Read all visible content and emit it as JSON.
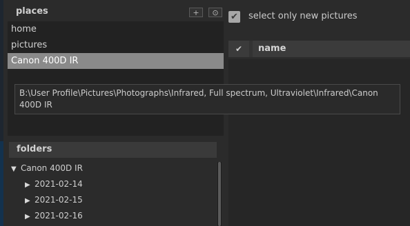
{
  "places": {
    "title": "places",
    "add_button": "+",
    "options_button": "⊙",
    "items": [
      {
        "label": "home",
        "selected": false
      },
      {
        "label": "pictures",
        "selected": false
      },
      {
        "label": "Canon 400D IR",
        "selected": true
      }
    ]
  },
  "tooltip": {
    "text": "B:\\User Profile\\Pictures\\Photographs\\Infrared, Full spectrum, Ultraviolet\\Infrared\\Canon 400D IR"
  },
  "folders": {
    "title": "folders",
    "items": [
      {
        "label": "Canon 400D IR",
        "expanded": true,
        "level": 0
      },
      {
        "label": "2021-02-14",
        "expanded": false,
        "level": 1
      },
      {
        "label": "2021-02-15",
        "expanded": false,
        "level": 1
      },
      {
        "label": "2021-02-16",
        "expanded": false,
        "level": 1
      }
    ]
  },
  "options": {
    "select_new_label": "select only new pictures",
    "select_new_checked": true
  },
  "table": {
    "check_column": "✔",
    "name_column": "name"
  },
  "colors": {
    "background": "#2b2b2b",
    "selected_row": "#8a8a8a",
    "header": "#3b3b3b"
  }
}
